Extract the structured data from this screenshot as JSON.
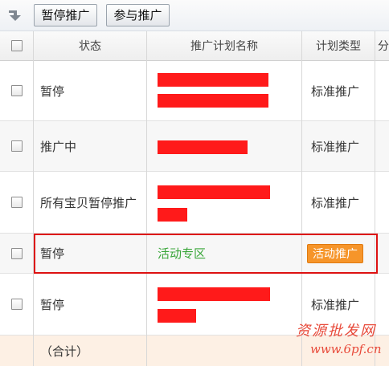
{
  "toolbar": {
    "icon": "collapse-arrow-icon",
    "pause_label": "暂停推广",
    "join_label": "参与推广"
  },
  "table": {
    "headers": {
      "status": "状态",
      "plan_name": "推广计划名称",
      "plan_type": "计划类型",
      "extra": "分"
    },
    "rows": [
      {
        "status": "暂停",
        "plan_name": "",
        "plan_type": "标准推广"
      },
      {
        "status": "推广中",
        "plan_name": "",
        "plan_type": "标准推广"
      },
      {
        "status": "所有宝贝暂停推广",
        "plan_name": "",
        "plan_type": "标准推广"
      },
      {
        "status": "暂停",
        "plan_name": "活动专区",
        "plan_type": "活动推广"
      },
      {
        "status": "暂停",
        "plan_name": "",
        "plan_type": "标准推广"
      }
    ],
    "total_label": "（合计）"
  },
  "watermark": {
    "line1": "资源批发网",
    "line2": "www.6pf.cn"
  },
  "colors": {
    "redaction": "#ff1a1a",
    "highlight_border": "#dd1111",
    "activity_tag": "#f6952a",
    "activity_text": "#3aa63a"
  }
}
